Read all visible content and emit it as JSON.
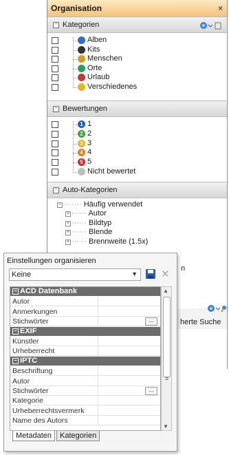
{
  "organisation": {
    "title": "Organisation",
    "close": "×",
    "kategorien": {
      "header": "Kategorien",
      "items": [
        {
          "label": "Alben",
          "icon": "album-icon",
          "color": "#2b6fd0"
        },
        {
          "label": "Kits",
          "icon": "kit-icon",
          "color": "#333333"
        },
        {
          "label": "Menschen",
          "icon": "people-icon",
          "color": "#d69a1d"
        },
        {
          "label": "Orte",
          "icon": "globe-icon",
          "color": "#2aa15a"
        },
        {
          "label": "Urlaub",
          "icon": "vacation-icon",
          "color": "#c8382f"
        },
        {
          "label": "Verschiedenes",
          "icon": "misc-icon",
          "color": "#e4b51c"
        }
      ]
    },
    "bewertungen": {
      "header": "Bewertungen",
      "items": [
        {
          "label": "1",
          "color": "#1f5fbf"
        },
        {
          "label": "2",
          "color": "#3aa63a"
        },
        {
          "label": "3",
          "color": "#e0b62b"
        },
        {
          "label": "4",
          "color": "#e57c1f"
        },
        {
          "label": "5",
          "color": "#cc2a2a"
        },
        {
          "label": "Nicht bewertet",
          "color": "#bdbdbd"
        }
      ]
    },
    "auto_kategorien": {
      "header": "Auto-Kategorien",
      "root": "Häufig verwendet",
      "items": [
        "Autor",
        "Bildtyp",
        "Blende",
        "Brennweite (1.5x)"
      ]
    },
    "partial_n": "n",
    "partial_search": "herte Suche"
  },
  "meta_panel": {
    "title": "Einstellungen organisieren",
    "preset": "Keine",
    "preset_arrow": "▼",
    "delete": "✕",
    "sections": [
      {
        "type": "cat",
        "label": "ACD Datenbank"
      },
      {
        "type": "row",
        "label": "Autor"
      },
      {
        "type": "row",
        "label": "Anmerkungen"
      },
      {
        "type": "row",
        "label": "Stichwörter",
        "button": "..."
      },
      {
        "type": "cat",
        "label": "EXIF"
      },
      {
        "type": "row",
        "label": "Künstler"
      },
      {
        "type": "row",
        "label": "Urheberrecht"
      },
      {
        "type": "cat",
        "label": "IPTC"
      },
      {
        "type": "row",
        "label": "Beschriftung"
      },
      {
        "type": "row",
        "label": "Autor"
      },
      {
        "type": "row",
        "label": "Stichwörter",
        "button": "..."
      },
      {
        "type": "row",
        "label": "Kategorie"
      },
      {
        "type": "row",
        "label": "Urheberrechtsvermerk"
      },
      {
        "type": "row",
        "label": "Name des Autors"
      }
    ],
    "tabs": [
      "Metadaten",
      "Kategorien"
    ]
  }
}
